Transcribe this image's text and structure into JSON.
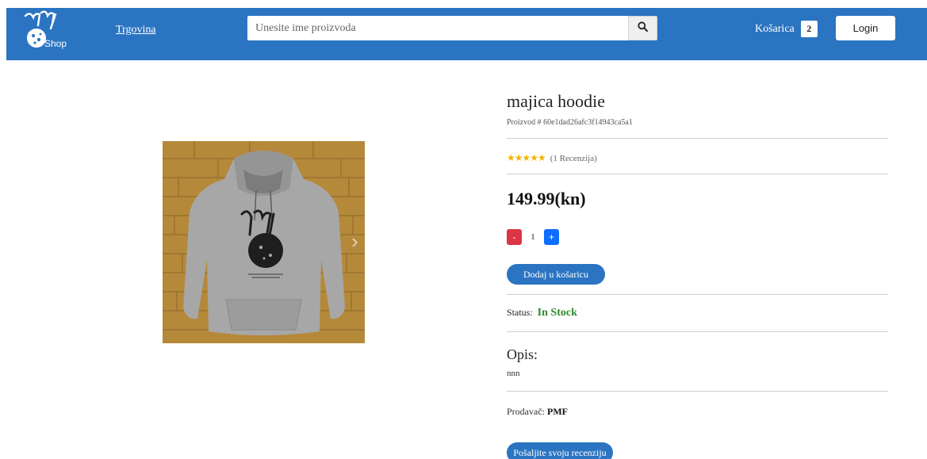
{
  "header": {
    "logo_text": "Shop",
    "nav_link": "Trgovina",
    "search_placeholder": "Unesite ime proizvoda",
    "cart_label": "Košarica",
    "cart_count": "2",
    "login_label": "Login"
  },
  "product": {
    "title": "majica hoodie",
    "id_text": "Proizvod # 60e1dad26afc3f14943ca5a1",
    "stars": "★★★★★",
    "reviews_text": "(1 Recenzija)",
    "price": "149.99(kn)",
    "quantity": "1",
    "minus_label": "-",
    "plus_label": "+",
    "add_to_cart_label": "Dodaj u košaricu",
    "status_label": "Status:",
    "status_value": "In Stock",
    "description_heading": "Opis:",
    "description_text": "nnn",
    "seller_label": "Prodavač:",
    "seller_name": "PMF",
    "review_button_label": "Pošaljite svoju recenziju"
  },
  "colors": {
    "header_bg": "#2a74c2",
    "in_stock": "#2e8b2e",
    "minus_btn": "#dc3545",
    "plus_btn": "#0d6efd",
    "star": "#f5b301"
  },
  "icons": {
    "search": "search-icon",
    "next": "chevron-right-icon",
    "logo": "pmf-shop-logo"
  }
}
